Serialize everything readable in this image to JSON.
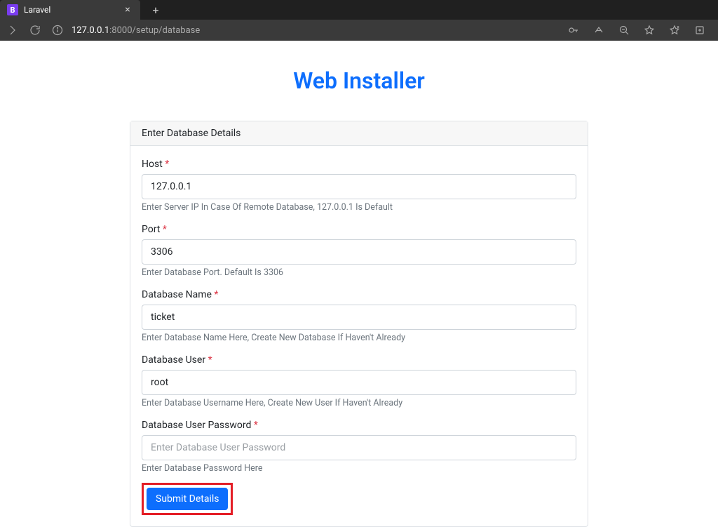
{
  "browser": {
    "tab": {
      "favicon_letter": "B",
      "title": "Laravel"
    },
    "url": {
      "host": "127.0.0.1",
      "path": ":8000/setup/database"
    }
  },
  "page": {
    "title": "Web Installer",
    "card_header": "Enter Database Details",
    "form": {
      "host": {
        "label": "Host",
        "value": "127.0.0.1",
        "helper": "Enter Server IP In Case Of Remote Database, 127.0.0.1 Is Default"
      },
      "port": {
        "label": "Port",
        "value": "3306",
        "helper": "Enter Database Port. Default Is 3306"
      },
      "dbname": {
        "label": "Database Name",
        "value": "ticket",
        "helper": "Enter Database Name Here, Create New Database If Haven't Already"
      },
      "dbuser": {
        "label": "Database User",
        "value": "root",
        "helper": "Enter Database Username Here, Create New User If Haven't Already"
      },
      "dbpass": {
        "label": "Database User Password",
        "placeholder": "Enter Database User Password",
        "helper": "Enter Database Password Here"
      },
      "submit_label": "Submit Details"
    }
  }
}
